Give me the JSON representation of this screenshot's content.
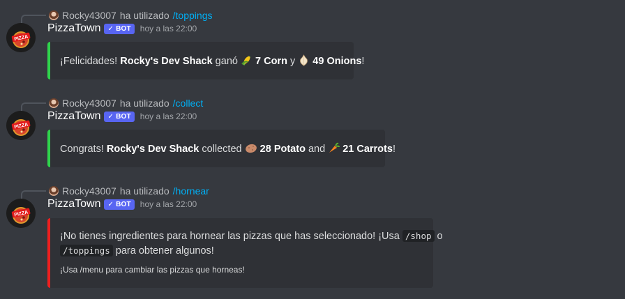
{
  "messages": [
    {
      "reply": {
        "user": "Rocky43007",
        "action": "ha utilizado",
        "command": "/toppings"
      },
      "author": "PizzaTown",
      "bot_tag": "BOT",
      "timestamp": "hoy a las 22:00",
      "embed": {
        "color": "#2fd34c",
        "p1": "¡Felicidades! ",
        "p2": "Rocky's Dev Shack",
        "p3": " ganó ",
        "p4": "7 Corn",
        "p5": " y ",
        "p6": "49 Onions",
        "p7": "!"
      }
    },
    {
      "reply": {
        "user": "Rocky43007",
        "action": "ha utilizado",
        "command": "/collect"
      },
      "author": "PizzaTown",
      "bot_tag": "BOT",
      "timestamp": "hoy a las 22:00",
      "embed": {
        "color": "#2fd34c",
        "p1": "Congrats! ",
        "p2": "Rocky's Dev Shack",
        "p3": " collected ",
        "p4": "28 Potato",
        "p5": " and ",
        "p6": "21 Carrots",
        "p7": "!"
      }
    },
    {
      "reply": {
        "user": "Rocky43007",
        "action": "ha utilizado",
        "command": "/hornear"
      },
      "author": "PizzaTown",
      "bot_tag": "BOT",
      "timestamp": "hoy a las 22:00",
      "embed": {
        "color": "#ed1f1f",
        "line1_a": "¡No tienes ingredientes para hornear las pizzas que has seleccionado! ¡Usa ",
        "code1": "/shop",
        "line1_b": " o",
        "code2": "/toppings",
        "line2_b": " para obtener algunos!",
        "footer": "¡Usa /menu para cambiar las pizzas que horneas!"
      }
    }
  ]
}
